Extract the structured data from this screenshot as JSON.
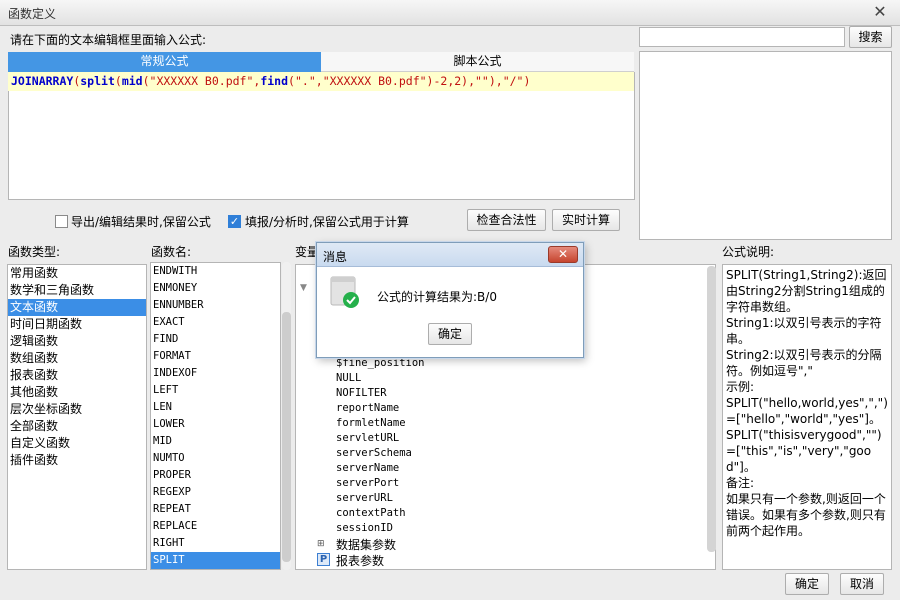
{
  "window": {
    "title": "函数定义",
    "close_symbol": "✕"
  },
  "editor": {
    "instruction": "请在下面的文本编辑框里面输入公式:",
    "tabs": [
      "常规公式",
      "脚本公式"
    ],
    "formula": {
      "fn_join": "JOINARRAY",
      "paren1": "(",
      "fn_split": "split",
      "paren2": "(",
      "fn_mid": "mid",
      "paren3": "(",
      "str1": "\"XXXXXX B0.pdf\"",
      "comma1": ",",
      "fn_find": "find",
      "paren4": "(",
      "str2": "\".\"",
      "comma2": ",",
      "str3": "\"XXXXXX B0.pdf\"",
      "tail": ")-2,2),\"\"),\"/\")"
    }
  },
  "options": {
    "export_label": "导出/编辑结果时,保留公式",
    "export_checked": false,
    "fill_label": "填报/分析时,保留公式用于计算",
    "fill_checked": true,
    "check_button": "检查合法性",
    "realtime_button": "实时计算"
  },
  "search": {
    "placeholder": "",
    "button": "搜索"
  },
  "function_types": {
    "header": "函数类型:",
    "items": [
      "常用函数",
      "数学和三角函数",
      "文本函数",
      "时间日期函数",
      "逻辑函数",
      "数组函数",
      "报表函数",
      "其他函数",
      "层次坐标函数",
      "全部函数",
      "自定义函数",
      "插件函数"
    ],
    "selected": "文本函数"
  },
  "function_names": {
    "header": "函数名:",
    "items": [
      "ENDWITH",
      "ENMONEY",
      "ENNUMBER",
      "EXACT",
      "FIND",
      "FORMAT",
      "INDEXOF",
      "LEFT",
      "LEN",
      "LOWER",
      "MID",
      "NUMTO",
      "PROPER",
      "REGEXP",
      "REPEAT",
      "REPLACE",
      "RIGHT",
      "SPLIT"
    ],
    "selected": "SPLIT"
  },
  "variables": {
    "header": "变量",
    "items": [
      "$fine_position",
      "NULL",
      "NOFILTER",
      "reportName",
      "formletName",
      "servletURL",
      "serverSchema",
      "serverName",
      "serverPort",
      "serverURL",
      "contextPath",
      "sessionID"
    ],
    "dataset_param": "数据集参数",
    "report_param": "报表参数"
  },
  "description": {
    "header": "公式说明:",
    "lines": [
      "SPLIT(String1,String2):返回由String2分割String1组成的字符串数组。",
      "String1:以双引号表示的字符串。",
      "String2:以双引号表示的分隔符。例如逗号\",\"",
      "示例:",
      "SPLIT(\"hello,world,yes\",\",\")=[\"hello\",\"world\",\"yes\"]。",
      "SPLIT(\"thisisverygood\",\"\")=[\"this\",\"is\",\"very\",\"good\"]。",
      "备注:",
      "如果只有一个参数,则返回一个错误。如果有多个参数,则只有前两个起作用。"
    ]
  },
  "footer": {
    "ok": "确定",
    "cancel": "取消"
  },
  "modal": {
    "title": "消息",
    "close_symbol": "✕",
    "message": "公式的计算结果为:B/0",
    "ok": "确定"
  }
}
